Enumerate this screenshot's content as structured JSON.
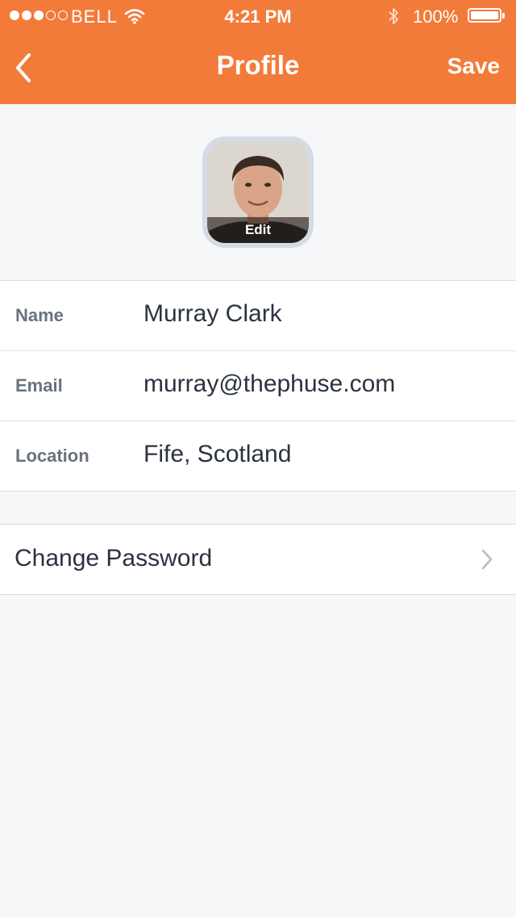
{
  "status_bar": {
    "carrier": "BELL",
    "time": "4:21 PM",
    "battery": "100%",
    "signal_strength_bars": 3,
    "signal_total_bars": 5,
    "battery_level": 1.0
  },
  "nav": {
    "title": "Profile",
    "save_label": "Save",
    "back_icon": "chevron-left-icon"
  },
  "avatar": {
    "edit_label": "Edit"
  },
  "fields": [
    {
      "label": "Name",
      "value": "Murray Clark"
    },
    {
      "label": "Email",
      "value": "murray@thephuse.com"
    },
    {
      "label": "Location",
      "value": "Fife, Scotland"
    }
  ],
  "change_password": {
    "label": "Change Password",
    "icon": "chevron-right-icon"
  },
  "colors": {
    "accent": "#f37b3a",
    "background": "#f6f7f9",
    "text": "#2b3340",
    "label": "#6a727d"
  }
}
